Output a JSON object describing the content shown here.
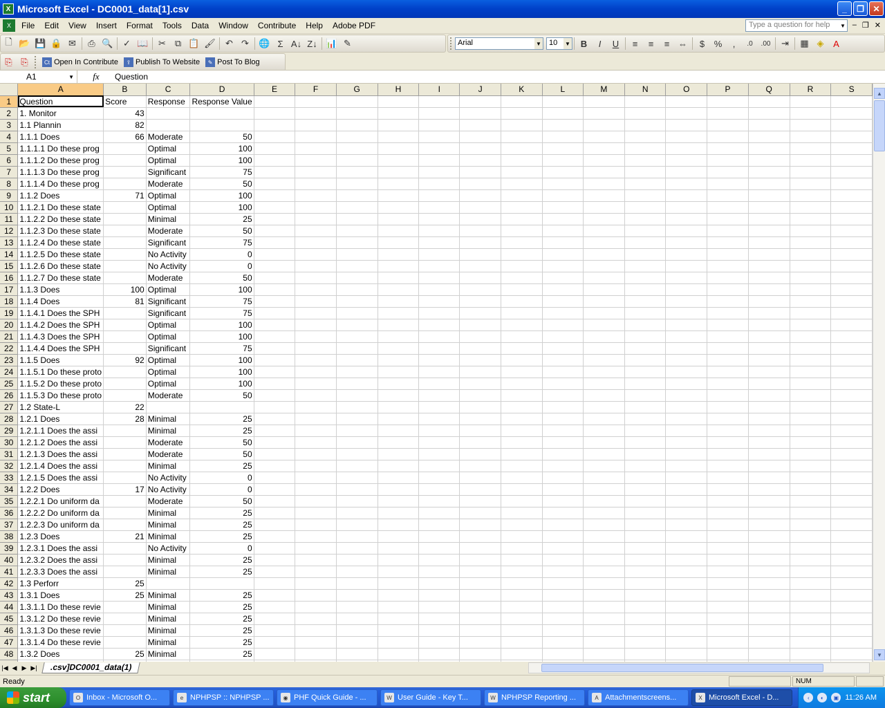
{
  "window": {
    "title": "Microsoft Excel - DC0001_data[1].csv"
  },
  "menu": [
    "File",
    "Edit",
    "View",
    "Insert",
    "Format",
    "Tools",
    "Data",
    "Window",
    "Contribute",
    "Help",
    "Adobe PDF"
  ],
  "help_box": {
    "placeholder": "Type a question for help"
  },
  "format_toolbar": {
    "font": "Arial",
    "size": "10"
  },
  "contribute_toolbar": {
    "open": "Open In Contribute",
    "publish": "Publish To Website",
    "blog": "Post To Blog"
  },
  "formula_bar": {
    "name_box": "A1",
    "fx": "fx",
    "content": "Question"
  },
  "columns": [
    "A",
    "B",
    "C",
    "D",
    "E",
    "F",
    "G",
    "H",
    "I",
    "J",
    "K",
    "L",
    "M",
    "N",
    "O",
    "P",
    "Q",
    "R",
    "S"
  ],
  "rows": [
    [
      "Question",
      "Score",
      "Response",
      "Response Value"
    ],
    [
      "1. Monitor",
      "43",
      "",
      ""
    ],
    [
      "1.1 Plannin",
      "82",
      "",
      ""
    ],
    [
      "1.1.1 Does",
      "66",
      "Moderate",
      "50"
    ],
    [
      "1.1.1.1 Do these prog",
      "",
      "Optimal",
      "100"
    ],
    [
      "1.1.1.2 Do these prog",
      "",
      "Optimal",
      "100"
    ],
    [
      "1.1.1.3 Do these prog",
      "",
      "Significant",
      "75"
    ],
    [
      "1.1.1.4  Do these prog",
      "",
      "Moderate",
      "50"
    ],
    [
      "1.1.2 Does",
      "71",
      "Optimal",
      "100"
    ],
    [
      "1.1.2.1 Do these state",
      "",
      "Optimal",
      "100"
    ],
    [
      "1.1.2.2 Do these state",
      "",
      "Minimal",
      "25"
    ],
    [
      "1.1.2.3 Do these state",
      "",
      "Moderate",
      "50"
    ],
    [
      "1.1.2.4 Do these state",
      "",
      "Significant",
      "75"
    ],
    [
      "1.1.2.5 Do these state",
      "",
      "No Activity",
      "0"
    ],
    [
      "1.1.2.6 Do these state",
      "",
      "No Activity",
      "0"
    ],
    [
      "1.1.2.7 Do these state",
      "",
      "Moderate",
      "50"
    ],
    [
      "1.1.3 Does",
      "100",
      "Optimal",
      "100"
    ],
    [
      "1.1.4 Does",
      "81",
      "Significant",
      "75"
    ],
    [
      "1.1.4.1 Does the SPH",
      "",
      "Significant",
      "75"
    ],
    [
      "1.1.4.2 Does the SPH",
      "",
      "Optimal",
      "100"
    ],
    [
      "1.1.4.3 Does the SPH",
      "",
      "Optimal",
      "100"
    ],
    [
      "1.1.4.4 Does the SPH",
      "",
      "Significant",
      "75"
    ],
    [
      "1.1.5 Does",
      "92",
      "Optimal",
      "100"
    ],
    [
      "1.1.5.1 Do these proto",
      "",
      "Optimal",
      "100"
    ],
    [
      "1.1.5.2 Do these proto",
      "",
      "Optimal",
      "100"
    ],
    [
      "1.1.5.3 Do these proto",
      "",
      "Moderate",
      "50"
    ],
    [
      "1.2 State-L",
      "22",
      "",
      ""
    ],
    [
      "1.2.1 Does",
      "28",
      "Minimal",
      "25"
    ],
    [
      "1.2.1.1 Does the assi",
      "",
      "Minimal",
      "25"
    ],
    [
      "1.2.1.2 Does the assi",
      "",
      "Moderate",
      "50"
    ],
    [
      "1.2.1.3 Does the assi",
      "",
      "Moderate",
      "50"
    ],
    [
      "1.2.1.4 Does the assi",
      "",
      "Minimal",
      "25"
    ],
    [
      "1.2.1.5 Does the assi",
      "",
      "No Activity",
      "0"
    ],
    [
      "1.2.2 Does",
      "17",
      "No Activity",
      "0"
    ],
    [
      "1.2.2.1 Do uniform da",
      "",
      "Moderate",
      "50"
    ],
    [
      "1.2.2.2 Do uniform da",
      "",
      "Minimal",
      "25"
    ],
    [
      "1.2.2.3 Do uniform da",
      "",
      "Minimal",
      "25"
    ],
    [
      "1.2.3 Does",
      "21",
      "Minimal",
      "25"
    ],
    [
      "1.2.3.1 Does the assi",
      "",
      "No Activity",
      "0"
    ],
    [
      "1.2.3.2 Does the assi",
      "",
      "Minimal",
      "25"
    ],
    [
      "1.2.3.3 Does the assi",
      "",
      "Minimal",
      "25"
    ],
    [
      "1.3 Perforr",
      "25",
      "",
      ""
    ],
    [
      "1.3.1 Does",
      "25",
      "Minimal",
      "25"
    ],
    [
      "1.3.1.1 Do these revie",
      "",
      "Minimal",
      "25"
    ],
    [
      "1.3.1.2 Do these revie",
      "",
      "Minimal",
      "25"
    ],
    [
      "1.3.1.3 Do these revie",
      "",
      "Minimal",
      "25"
    ],
    [
      "1.3.1.4 Do these revie",
      "",
      "Minimal",
      "25"
    ],
    [
      "1.3.2 Does",
      "25",
      "Minimal",
      "25"
    ],
    [
      "",
      "",
      "",
      ""
    ]
  ],
  "sheet_tab": ".csv]DC0001_data(1)",
  "status": {
    "text": "Ready",
    "num": "NUM"
  },
  "taskbar": {
    "start": "start",
    "items": [
      "Inbox - Microsoft O...",
      "NPHPSP :: NPHPSP ...",
      "PHF Quick Guide - ...",
      "User Guide - Key T...",
      "NPHPSP Reporting ...",
      "Attachmentscreens...",
      "Microsoft Excel - D..."
    ],
    "clock": "11:26 AM"
  }
}
